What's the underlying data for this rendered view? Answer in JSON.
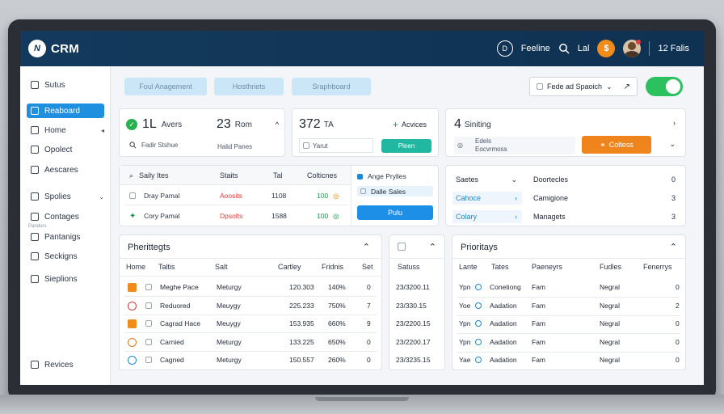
{
  "header": {
    "logo_mark": "N",
    "app_name": "CRM",
    "status_icon_char": "D",
    "status_label": "Feeline",
    "search_label": "Lal",
    "orange_badge": "$",
    "count_label": "12 Falis"
  },
  "sidebar": {
    "items": [
      {
        "label": "Sutus",
        "active": false,
        "chevron": ""
      },
      {
        "label": "Reaboard",
        "active": true,
        "chevron": ""
      },
      {
        "label": "Home",
        "active": false,
        "chevron": "◂"
      },
      {
        "label": "Opolect",
        "active": false,
        "chevron": ""
      },
      {
        "label": "Aescares",
        "active": false,
        "chevron": ""
      },
      {
        "label": "Spolies",
        "active": false,
        "chevron": "⌄"
      },
      {
        "label": "Contages",
        "active": false,
        "chevron": ""
      },
      {
        "label": "Pantanigs",
        "active": false,
        "chevron": ""
      },
      {
        "label": "Seckigns",
        "active": false,
        "chevron": ""
      },
      {
        "label": "Sieplions",
        "active": false,
        "chevron": ""
      },
      {
        "label": "Revices",
        "active": false,
        "chevron": ""
      }
    ],
    "sub_label": "Pandurs"
  },
  "toolbar": {
    "btn1": "Foul Anagement",
    "btn2": "Hosthriets",
    "btn3": "Sraphboard",
    "filter_label": "Fede ad Spaoich",
    "filter_chevron": "⌄"
  },
  "kpis": {
    "k1": {
      "value": "1L",
      "label": "Avers",
      "sub1": "Fadir Stshue",
      "sub2": "Halid Panes"
    },
    "k2": {
      "value": "23",
      "label": "Rom",
      "sub1": "",
      "sub2": ""
    },
    "k3": {
      "value": "372",
      "label": "TA",
      "action": "Acvices",
      "field": "Yarut",
      "button": "Pleen"
    },
    "k4": {
      "value": "4",
      "label": "Siniting",
      "line1": "Edels",
      "line2": "Eocvrmoss",
      "button": "Coltess"
    }
  },
  "tasks": {
    "headers": [
      "Saily Ites",
      "Staits",
      "Tal",
      "Colticnes"
    ],
    "rows": [
      {
        "name": "Dray Pamal",
        "status": "Aoosits",
        "tal": "1108",
        "val": "100"
      },
      {
        "name": "Cory Pamal",
        "status": "Dpsolts",
        "tal": "1588",
        "val": "100"
      }
    ],
    "side_items": [
      "Ange Prylles",
      "Dalle Sales"
    ],
    "side_button": "Pulu"
  },
  "settings": {
    "rows": [
      {
        "left": "Saetes",
        "right": "Doortecles",
        "count": "0"
      },
      {
        "left": "Cahoce",
        "right": "Camigione",
        "count": "3"
      },
      {
        "left": "Colary",
        "right": "Managets",
        "count": "3"
      }
    ]
  },
  "table_left": {
    "title": "Pherittegts",
    "headers": [
      "Home",
      "Taltis",
      "Salt",
      "Cartley",
      "Fridnis",
      "Set"
    ],
    "rows": [
      {
        "name": "Meghe Pace",
        "type": "Meturgy",
        "num": "120.303",
        "pct": "140%",
        "n": "0"
      },
      {
        "name": "Reduored",
        "type": "Meuygy",
        "num": "225.233",
        "pct": "750%",
        "n": "7"
      },
      {
        "name": "Cagrad Hace",
        "type": "Meuygy",
        "num": "153.935",
        "pct": "660%",
        "n": "9"
      },
      {
        "name": "Carnied",
        "type": "Meturgy",
        "num": "133.225",
        "pct": "650%",
        "n": "0"
      },
      {
        "name": "Cagned",
        "type": "Meturgy",
        "num": "150.557",
        "pct": "260%",
        "n": "0"
      }
    ]
  },
  "table_mid": {
    "header": "Satuss",
    "rows": [
      "23/3200.11",
      "23/330.15",
      "23/2200.15",
      "23/2200.17",
      "23/3235.15"
    ]
  },
  "table_right": {
    "title": "Prioritays",
    "headers": [
      "Lante",
      "Tates",
      "Paeneyrs",
      "Fudles",
      "Fenerrys"
    ],
    "rows": [
      {
        "a": "Ypn",
        "b": "Conetiong",
        "c": "Fam",
        "d": "Negral",
        "e": "0"
      },
      {
        "a": "Yoe",
        "b": "Aadation",
        "c": "Fam",
        "d": "Negral",
        "e": "2"
      },
      {
        "a": "Ypn",
        "b": "Aadation",
        "c": "Fam",
        "d": "Negral",
        "e": "0"
      },
      {
        "a": "Ypn",
        "b": "Aadation",
        "c": "Fam",
        "d": "Negral",
        "e": "0"
      },
      {
        "a": "Yae",
        "b": "Aadation",
        "c": "Fam",
        "d": "Negral",
        "e": "0"
      }
    ]
  },
  "colors": {
    "topbar": "#133a5c",
    "accent_blue": "#1f8fe0",
    "toggle_green": "#2bc15f",
    "orange": "#f0841c",
    "teal": "#21b7a0"
  }
}
